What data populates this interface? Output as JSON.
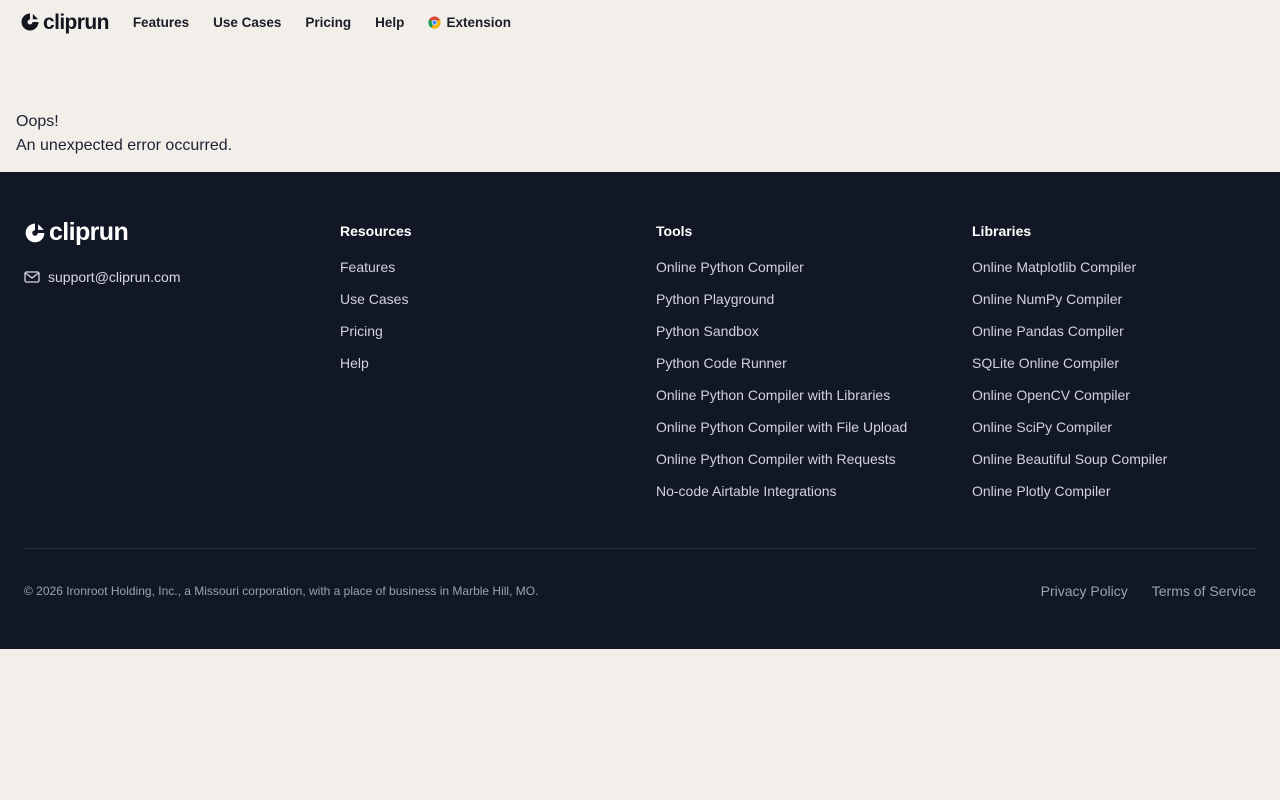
{
  "brand": {
    "name": "cliprun"
  },
  "nav": {
    "items": [
      {
        "label": "Features"
      },
      {
        "label": "Use Cases"
      },
      {
        "label": "Pricing"
      },
      {
        "label": "Help"
      }
    ],
    "extension_label": "Extension"
  },
  "error": {
    "title": "Oops!",
    "message": "An unexpected error occurred."
  },
  "footer": {
    "brand": "cliprun",
    "email": "support@cliprun.com",
    "columns": [
      {
        "title": "Resources",
        "links": [
          "Features",
          "Use Cases",
          "Pricing",
          "Help"
        ]
      },
      {
        "title": "Tools",
        "links": [
          "Online Python Compiler",
          "Python Playground",
          "Python Sandbox",
          "Python Code Runner",
          "Online Python Compiler with Libraries",
          "Online Python Compiler with File Upload",
          "Online Python Compiler with Requests",
          "No-code Airtable Integrations"
        ]
      },
      {
        "title": "Libraries",
        "links": [
          "Online Matplotlib Compiler",
          "Online NumPy Compiler",
          "Online Pandas Compiler",
          "SQLite Online Compiler",
          "Online OpenCV Compiler",
          "Online SciPy Compiler",
          "Online Beautiful Soup Compiler",
          "Online Plotly Compiler"
        ]
      }
    ],
    "copyright": "© 2026 Ironroot Holding, Inc., a Missouri corporation, with a place of business in Marble Hill, MO.",
    "legal": {
      "privacy": "Privacy Policy",
      "terms": "Terms of Service"
    }
  },
  "colors": {
    "page_bg": "#f2efea",
    "footer_bg": "#121726",
    "text_dark": "#1a1c26",
    "footer_muted": "#9ca1b0"
  },
  "icons": {
    "logo": "cliprun-logo-icon",
    "extension": "chrome-icon",
    "email": "mail-icon"
  }
}
